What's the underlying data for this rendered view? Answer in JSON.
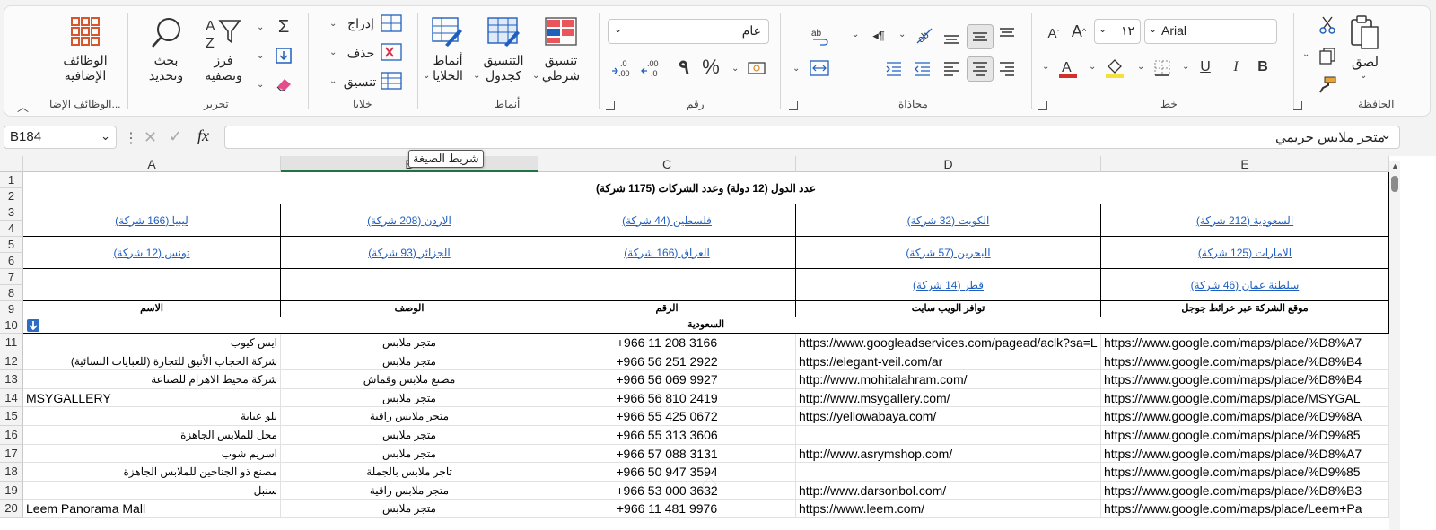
{
  "ribbon": {
    "clipboard": {
      "paste": "لصق",
      "group": "الحافظة"
    },
    "font": {
      "name": "Arial",
      "size": "١٢",
      "bold": "B",
      "italic": "I",
      "underline": "U",
      "group": "خط"
    },
    "alignment": {
      "group": "محاذاة"
    },
    "number": {
      "format": "عام",
      "percent": "%",
      "comma": "٩",
      "group": "رقم"
    },
    "styles": {
      "conditional_1": "تنسيق",
      "conditional_2": "شرطي",
      "table_1": "التنسيق",
      "table_2": "كجدول",
      "cell_1": "أنماط",
      "cell_2": "الخلايا",
      "group": "أنماط"
    },
    "cells": {
      "insert": "إدراج",
      "delete": "حذف",
      "format": "تنسيق",
      "group": "خلايا"
    },
    "editing": {
      "sort_1": "فرز",
      "sort_2": "وتصفية",
      "find_1": "بحث",
      "find_2": "وتحديد",
      "group": "تحرير"
    },
    "addins": {
      "l1": "الوظائف",
      "l2": "الإضافية",
      "group": "الوظائف الإضا..."
    }
  },
  "formula_bar": {
    "name_box": "B184",
    "fx": "fx",
    "value": "متجر ملابس حريمي",
    "tooltip": "شريط الصيغة"
  },
  "columns": [
    "A",
    "B",
    "C",
    "D",
    "E"
  ],
  "rows": [
    "1",
    "2",
    "3",
    "4",
    "5",
    "6",
    "7",
    "8",
    "9",
    "10",
    "11",
    "12",
    "13",
    "14",
    "15",
    "16",
    "17",
    "18",
    "19",
    "20"
  ],
  "sheet": {
    "title": "عدد الدول (12 دولة) وعدد الشركات (1175 شركة)",
    "countries": [
      [
        "ليبيا (166 شركة)",
        "الاردن (208 شركة)",
        "فلسطين (44 شركة)",
        "الكويت (32 شركة)",
        "السعودية (212 شركة)"
      ],
      [
        "تونس (12 شركة)",
        "الجزائر (93 شركة)",
        "العراق (166 شركة)",
        "البحرين (57 شركة)",
        "الامارات (125 شركة)"
      ],
      [
        "",
        "",
        "",
        "قطر (14 شركة)",
        "سلطنة عمان (46 شركة)"
      ]
    ],
    "headers": [
      "الاسم",
      "الوصف",
      "الرقم",
      "توافر الويب سايت",
      "موقع الشركة عبر خرائط جوجل"
    ],
    "section": "السعودية",
    "data": [
      [
        "ايس كيوب",
        "متجر ملابس",
        "+966 11 208 3166",
        "https://www.googleadservices.com/pagead/aclk?sa=L",
        "https://www.google.com/maps/place/%D8%A7"
      ],
      [
        "شركة الحجاب الأنيق للتجارة (للعبايات النسائية)",
        "متجر ملابس",
        "+966 56 251 2922",
        "https://elegant-veil.com/ar",
        "https://www.google.com/maps/place/%D8%B4"
      ],
      [
        "شركة محيط الاهرام للصناعة",
        "مصنع ملابس وقماش",
        "+966 56 069 9927",
        "http://www.mohitalahram.com/",
        "https://www.google.com/maps/place/%D8%B4"
      ],
      [
        "MSYGALLERY",
        "متجر ملابس",
        "+966 56 810 2419",
        "http://www.msygallery.com/",
        "https://www.google.com/maps/place/MSYGAL"
      ],
      [
        "يلو عباية",
        "متجر ملابس راقية",
        "+966 55 425 0672",
        "https://yellowabaya.com/",
        "https://www.google.com/maps/place/%D9%8A"
      ],
      [
        "محل للملابس الجاهزة",
        "متجر ملابس",
        "+966 55 313 3606",
        "",
        "https://www.google.com/maps/place/%D9%85"
      ],
      [
        "اسريم شوب",
        "متجر ملابس",
        "+966 57 088 3131",
        "http://www.asrymshop.com/",
        "https://www.google.com/maps/place/%D8%A7"
      ],
      [
        "مصنع ذو الجناحين للملابس الجاهزة",
        "تاجر ملابس بالجملة",
        "+966 50 947 3594",
        "",
        "https://www.google.com/maps/place/%D9%85"
      ],
      [
        "سنبل",
        "متجر ملابس راقية",
        "+966 53 000 3632",
        "http://www.darsonbol.com/",
        "https://www.google.com/maps/place/%D8%B3"
      ],
      [
        "Leem Panorama Mall",
        "متجر ملابس",
        "+966 11 481 9976",
        "https://www.leem.com/",
        "https://www.google.com/maps/place/Leem+Pa"
      ]
    ]
  }
}
